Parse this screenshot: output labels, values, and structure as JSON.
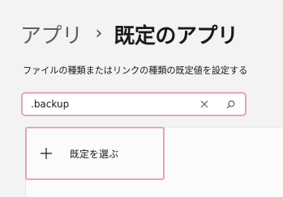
{
  "breadcrumb": {
    "parent": "アプリ",
    "separator": "›",
    "current": "既定のアプリ"
  },
  "description": "ファイルの種類またはリンクの種類の既定値を設定する",
  "search": {
    "value": ".backup",
    "placeholder": "",
    "clear_icon": "close-icon",
    "search_icon": "search-icon"
  },
  "choose_default": {
    "icon": "plus-icon",
    "label": "既定を選ぶ"
  },
  "colors": {
    "highlight": "#e2a4c2",
    "background": "#f3f3f3",
    "card": "#fbfbfb"
  }
}
